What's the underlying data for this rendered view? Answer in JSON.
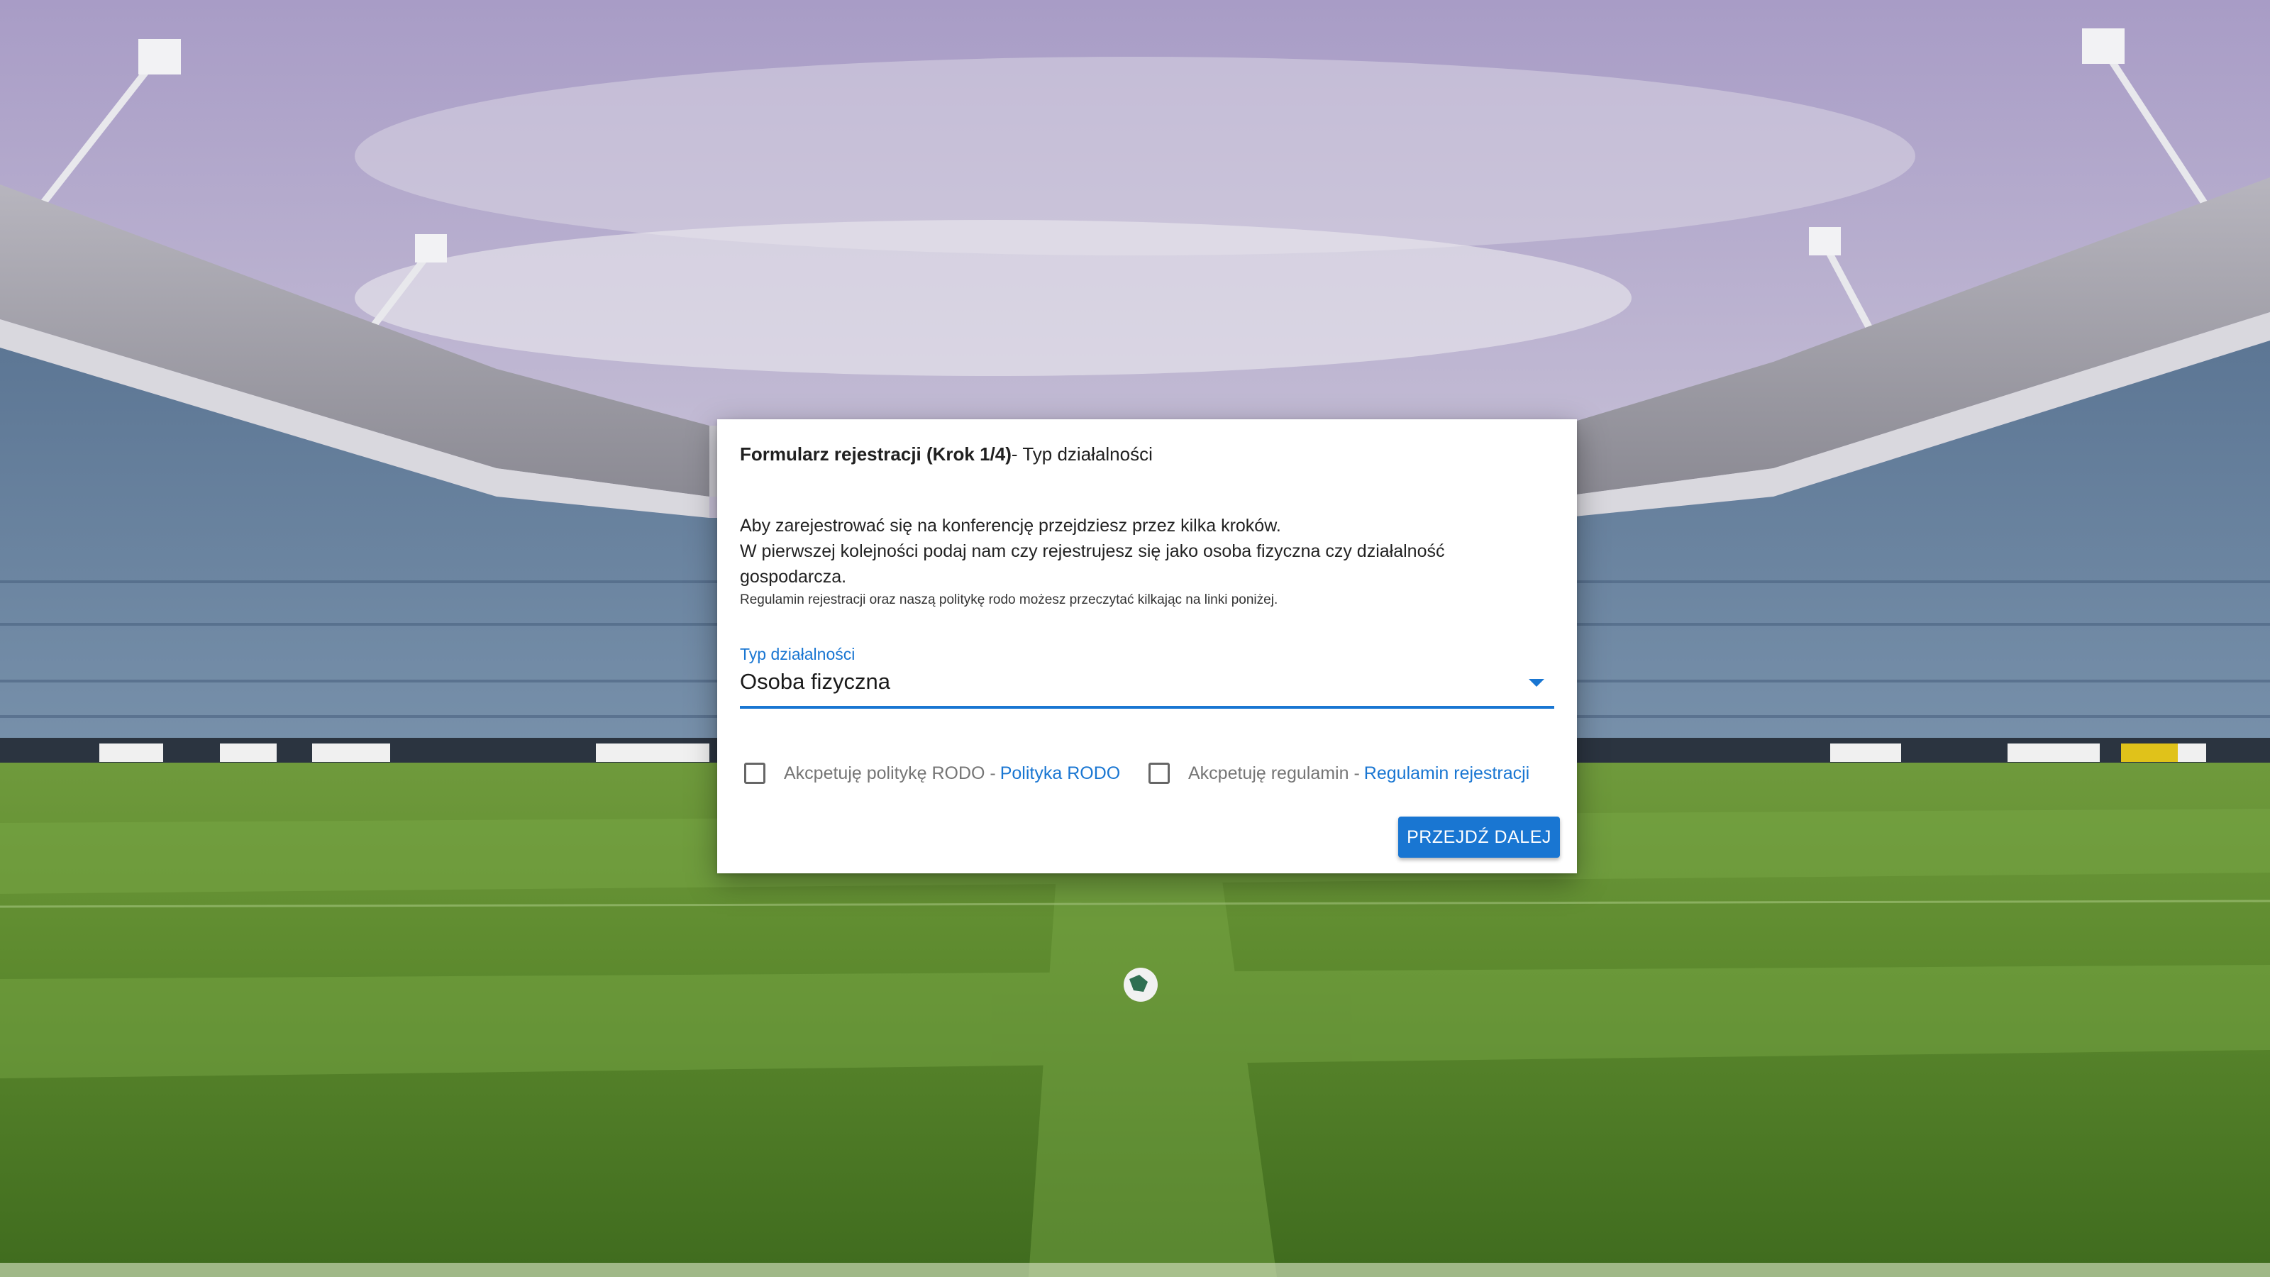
{
  "dialog": {
    "title_bold": "Formularz rejestracji (Krok 1/4)",
    "title_rest": "- Typ działalności",
    "intro_line1": "Aby zarejestrować się na konferencję przejdziesz przez kilka kroków.",
    "intro_line2": "W pierwszej kolejności podaj nam czy rejestrujesz się jako osoba fizyczna czy działalność gospodarcza.",
    "small_note": "Regulamin rejestracji oraz naszą politykę rodo możesz przeczytać kilkając na linki poniżej.",
    "select": {
      "label": "Typ działalności",
      "value": "Osoba fizyczna"
    },
    "checkbox_rodo": {
      "label": "Akcpetuję politykę RODO -",
      "link": "Polityka RODO",
      "checked": false
    },
    "checkbox_terms": {
      "label": "Akcpetuję regulamin -",
      "link": "Regulamin rejestracji",
      "checked": false
    },
    "next_button": "PRZEJDŹ DALEJ"
  },
  "colors": {
    "accent": "#1976d2",
    "dialog_bg": "#ffffff"
  },
  "icons": {
    "select_arrow": "caret-down-icon"
  }
}
